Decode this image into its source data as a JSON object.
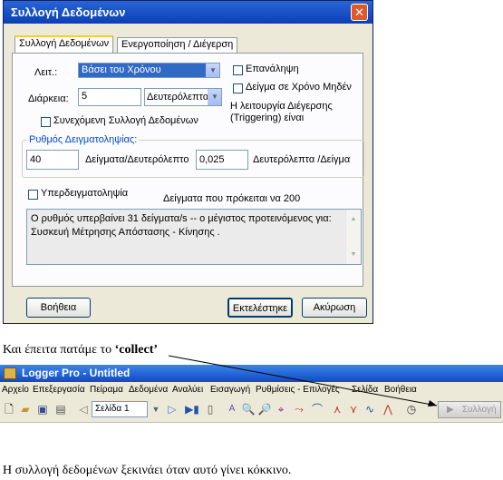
{
  "dialog": {
    "title": "Συλλογή Δεδομένων",
    "close_glyph": "✕",
    "tabs": [
      "Συλλογή Δεδομένων",
      "Ενεργοποίηση / Διέγερση"
    ],
    "mode_label": "Λειτ.:",
    "mode_value": "Βάσει του Χρόνου",
    "duration_label": "Διάρκεια:",
    "duration_value": "5",
    "duration_unit": "Δευτερόλεπτα",
    "repeat_label": "Επανάληψη",
    "sample_zero_label": "Δείγμα σε Χρόνο Μηδέν",
    "trigger_note_line1": "Η λειτουργία Διέγερσης",
    "trigger_note_line2": "(Triggering) είναι",
    "continuous_label": "Συνεχόμενη Συλλογή Δεδομένων",
    "rate_group_label": "Ρυθμός Δειγματοληψίας:",
    "rate_value": "40",
    "rate_unit": "Δείγματα/Δευτερόλεπτο",
    "interval_value": "0,025",
    "interval_unit": "Δευτερόλεπτα /Δείγμα",
    "oversampling_label": "Υπερδειγματοληψία",
    "samples_label": "Δείγματα που πρόκειται να  200",
    "message_line1": "Ο ρυθμός υπερβαίνει 31 δείγματα/s -- ο μέγιστος προτεινόμενος για:",
    "message_line2": "Συσκευή Μέτρησης Απόστασης - Κίνησης .",
    "help_button": "Βοήθεια",
    "run_button": "Εκτελέστηκε",
    "cancel_button": "Ακύρωση"
  },
  "caption1_prefix": "Και έπειτα πατάμε το ",
  "caption1_bold": "‘collect’",
  "logger": {
    "title": "Logger Pro - Untitled",
    "menu": [
      "Αρχείο",
      "Επεξεργασία",
      "Πείραμα",
      "Δεδομένα",
      "Αναλύει",
      "Εισαγωγή",
      "Ρυθμίσεις - Επιλογές",
      "Σελίδα",
      "Βοήθεια"
    ],
    "page_select": "Σελίδα 1",
    "collect_label": "Συλλογή"
  },
  "caption2": "Η συλλογή δεδομένων ξεκινάει όταν αυτό γίνει κόκκινο.",
  "colors": {
    "titlebar": "#0b3fb5",
    "group_label": "#0046d5",
    "collect_arrow": "#000000"
  }
}
